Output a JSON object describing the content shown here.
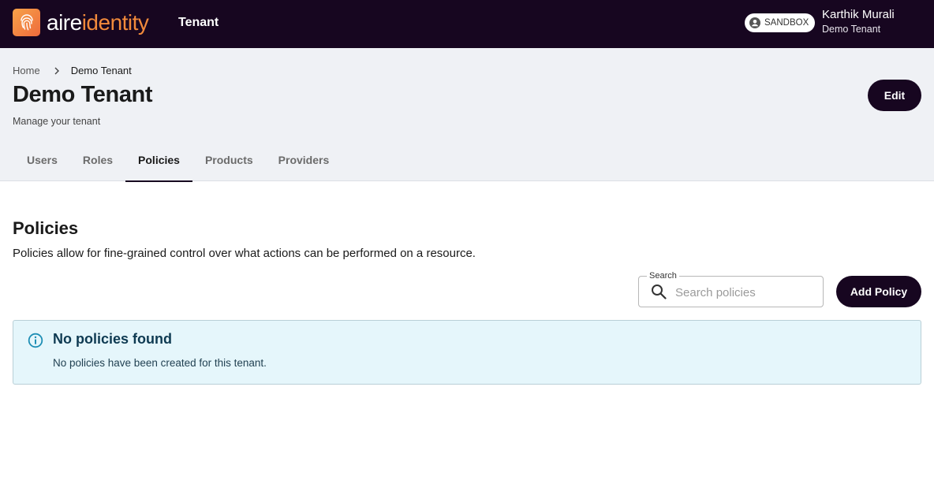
{
  "navbar": {
    "brand_part1": "aire",
    "brand_part2": "identity",
    "app_title": "Tenant",
    "environment_badge": "SANDBOX",
    "user_name": "Karthik Murali",
    "user_tenant": "Demo Tenant",
    "logo_icon": "fingerprint-icon",
    "colors": {
      "navbar_bg": "#170620",
      "brand_accent": "#f28a3b"
    }
  },
  "header": {
    "breadcrumb": {
      "home": "Home",
      "current": "Demo Tenant"
    },
    "title": "Demo Tenant",
    "subtitle": "Manage your tenant",
    "edit_label": "Edit",
    "tabs": [
      {
        "label": "Users",
        "active": false
      },
      {
        "label": "Roles",
        "active": false
      },
      {
        "label": "Policies",
        "active": true
      },
      {
        "label": "Products",
        "active": false
      },
      {
        "label": "Providers",
        "active": false
      }
    ]
  },
  "policies": {
    "title": "Policies",
    "description": "Policies allow for fine-grained control over what actions can be performed on a resource.",
    "search": {
      "label": "Search",
      "placeholder": "Search policies",
      "value": ""
    },
    "add_label": "Add Policy",
    "alert": {
      "title": "No policies found",
      "text": "No policies have been created for this tenant.",
      "icon": "info-icon",
      "color": "#e5f6fb"
    }
  }
}
